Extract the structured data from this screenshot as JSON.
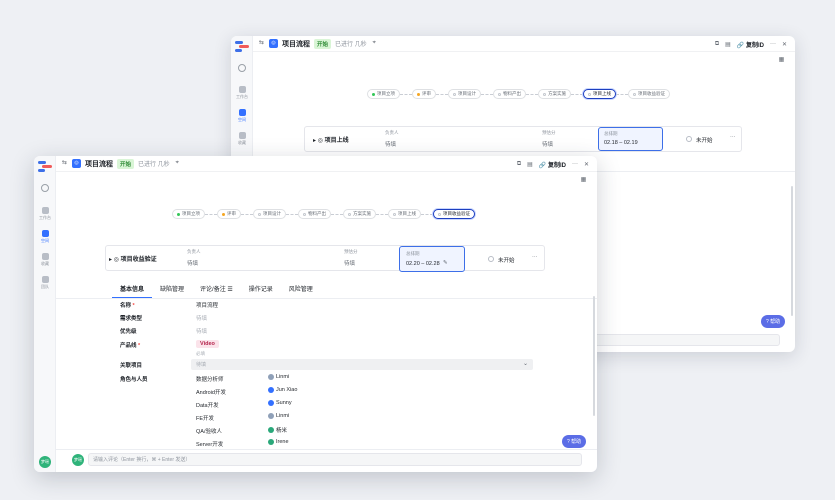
{
  "back_window": {
    "title": "项目流程",
    "tag": "开始",
    "status": "已进行 几秒",
    "copy_id": "复制ID",
    "flow": [
      "项目立项",
      "评审",
      "项目设计",
      "物料产出",
      "方案实施",
      "项目上线",
      "项目收益验证"
    ],
    "card": {
      "name": "项目上线",
      "owner_label": "负责人",
      "owner_value": "待填",
      "estimate_label": "预估分",
      "estimate_value": "待填",
      "date_label": "总排期",
      "date_value": "02.18 – 02.19",
      "status": "未开始"
    },
    "help": "帮助"
  },
  "front_window": {
    "title": "项目流程",
    "tag": "开始",
    "status": "已进行 几秒",
    "copy_id": "复制ID",
    "sidebar": [
      "工作台",
      "空间",
      "收藏",
      "团队"
    ],
    "user_avatar": "梦瑶",
    "flow": [
      "项目立项",
      "评审",
      "项目设计",
      "物料产出",
      "方案实施",
      "项目上线",
      "项目收益验证"
    ],
    "card": {
      "name": "项目收益验证",
      "owner_label": "负责人",
      "owner_value": "待填",
      "estimate_label": "预估分",
      "estimate_value": "待填",
      "date_label": "总排期",
      "date_value": "02.20 – 02.28",
      "status": "未开始"
    },
    "tabs": [
      "基本信息",
      "缺陷管理",
      "评论/备注",
      "操作记录",
      "风险管理"
    ],
    "fields": {
      "name_label": "名称",
      "name_value": "项目流程",
      "req_type_label": "需求类型",
      "req_type_value": "待填",
      "priority_label": "优先级",
      "priority_value": "待填",
      "product_line_label": "产品线",
      "product_line_value": "Video",
      "product_line_hint": "必填",
      "related_label": "关联项目",
      "related_value": "待填",
      "roles_label": "角色与人员"
    },
    "roles": [
      {
        "role": "数据分析师",
        "person": "Linmi"
      },
      {
        "role": "Android开发",
        "person": "Jun Xiao"
      },
      {
        "role": "Data开发",
        "person": "Sunny"
      },
      {
        "role": "FE开发",
        "person": "Linmi"
      },
      {
        "role": "QA/验收人",
        "person": "杨米"
      },
      {
        "role": "Server开发",
        "person": "Irene"
      }
    ],
    "comment_placeholder": "请输入评论（Enter 换行，⌘ + Enter 发送）",
    "help": "帮助"
  }
}
